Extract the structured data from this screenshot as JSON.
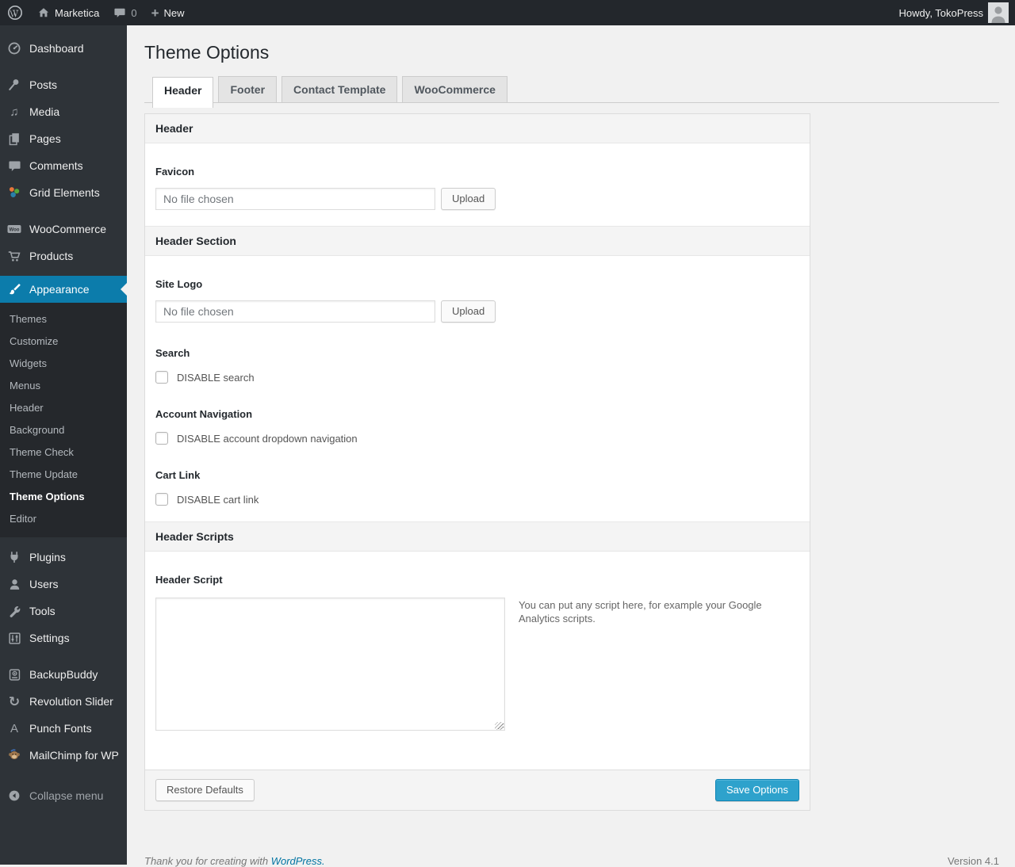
{
  "colors": {
    "admin_bar_bg": "#23272c",
    "menu_bg": "#2e3338",
    "submenu_bg": "#25282c",
    "menu_highlight": "#0c7cab",
    "primary_button": "#2ea2cc",
    "primary_button_border": "#0e84b5",
    "link": "#0074a2",
    "page_bg": "#f1f1f1"
  },
  "icons": {
    "media_glyph": "♫",
    "revolution_slider_glyph": "↻",
    "punch_fonts_glyph": "A",
    "plus_glyph": "+"
  },
  "admin_bar": {
    "site_name": "Marketica",
    "comment_count": "0",
    "new_label": "New",
    "howdy": "Howdy, TokoPress"
  },
  "sidebar": {
    "menu": [
      {
        "label": "Dashboard"
      },
      {
        "label": "Posts"
      },
      {
        "label": "Media"
      },
      {
        "label": "Pages"
      },
      {
        "label": "Comments"
      },
      {
        "label": "Grid Elements"
      },
      {
        "label": "WooCommerce"
      },
      {
        "label": "Products"
      },
      {
        "label": "Appearance"
      },
      {
        "label": "Plugins"
      },
      {
        "label": "Users"
      },
      {
        "label": "Tools"
      },
      {
        "label": "Settings"
      },
      {
        "label": "BackupBuddy"
      },
      {
        "label": "Revolution Slider"
      },
      {
        "label": "Punch Fonts"
      },
      {
        "label": "MailChimp for WP"
      },
      {
        "label": "Collapse menu"
      }
    ],
    "appearance_submenu": [
      {
        "label": "Themes"
      },
      {
        "label": "Customize"
      },
      {
        "label": "Widgets"
      },
      {
        "label": "Menus"
      },
      {
        "label": "Header"
      },
      {
        "label": "Background"
      },
      {
        "label": "Theme Check"
      },
      {
        "label": "Theme Update"
      },
      {
        "label": "Theme Options"
      },
      {
        "label": "Editor"
      }
    ]
  },
  "main": {
    "title": "Theme Options",
    "tabs": [
      {
        "label": "Header"
      },
      {
        "label": "Footer"
      },
      {
        "label": "Contact Template"
      },
      {
        "label": "WooCommerce"
      }
    ],
    "panel": {
      "section1_title": "Header",
      "favicon": {
        "label": "Favicon",
        "placeholder": "No file chosen",
        "upload_label": "Upload"
      },
      "section2_title": "Header Section",
      "site_logo": {
        "label": "Site Logo",
        "placeholder": "No file chosen",
        "upload_label": "Upload"
      },
      "search": {
        "label": "Search",
        "checkbox_label": "DISABLE search"
      },
      "account_navigation": {
        "label": "Account Navigation",
        "checkbox_label": "DISABLE account dropdown navigation"
      },
      "cart_link": {
        "label": "Cart Link",
        "checkbox_label": "DISABLE cart link"
      },
      "section3_title": "Header Scripts",
      "header_script": {
        "label": "Header Script",
        "hint": "You can put any script here, for example your Google Analytics scripts."
      },
      "footer": {
        "restore_label": "Restore Defaults",
        "save_label": "Save Options"
      }
    }
  },
  "page_footer": {
    "thanks_prefix": "Thank you for creating with ",
    "wordpress_link": "WordPress.",
    "version": "Version 4.1"
  }
}
